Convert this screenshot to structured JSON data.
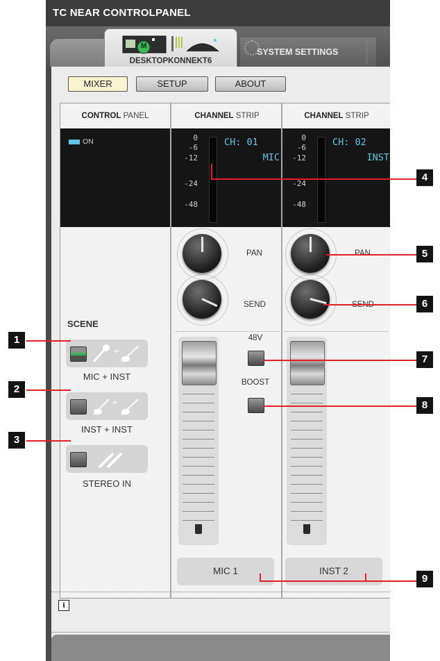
{
  "window": {
    "title": "TC NEAR CONTROLPANEL",
    "tabs": [
      {
        "label": "DESKTOPKONNEKT6",
        "active": true,
        "badge": "M"
      },
      {
        "label": "SYSTEM SETTINGS",
        "active": false
      }
    ]
  },
  "mode_buttons": {
    "mixer": "MIXER",
    "setup": "SETUP",
    "about": "ABOUT"
  },
  "control_panel": {
    "heading_bold": "CONTROL",
    "heading_rest": " PANEL",
    "on_label": "ON",
    "scene_heading": "SCENE",
    "scenes": [
      {
        "label": "MIC + INST",
        "active": true
      },
      {
        "label": "INST + INST",
        "active": false
      },
      {
        "label": "STEREO IN",
        "active": false
      }
    ]
  },
  "channels": [
    {
      "heading_bold": "CHANNEL",
      "heading_rest": " STRIP",
      "channel_id": "CH: 01",
      "input_type": "MIC",
      "meter_scale": [
        "0",
        "-6",
        "-12",
        "-24",
        "-48"
      ],
      "pan_label": "PAN",
      "send_label": "SEND",
      "phantom_label": "48V",
      "boost_label": "BOOST",
      "name": "MIC 1"
    },
    {
      "heading_bold": "CHANNEL",
      "heading_rest": " STRIP",
      "channel_id": "CH: 02",
      "input_type": "INST",
      "meter_scale": [
        "0",
        "-6",
        "-12",
        "-24",
        "-48"
      ],
      "pan_label": "PAN",
      "send_label": "SEND",
      "name": "INST 2"
    }
  ],
  "info_icon": "i",
  "callouts": [
    "1",
    "2",
    "3",
    "4",
    "5",
    "6",
    "7",
    "8",
    "9"
  ],
  "colors": {
    "accent_cyan": "#5cc8e2",
    "callout_red": "#e0202a",
    "active_green": "#3db35a"
  }
}
